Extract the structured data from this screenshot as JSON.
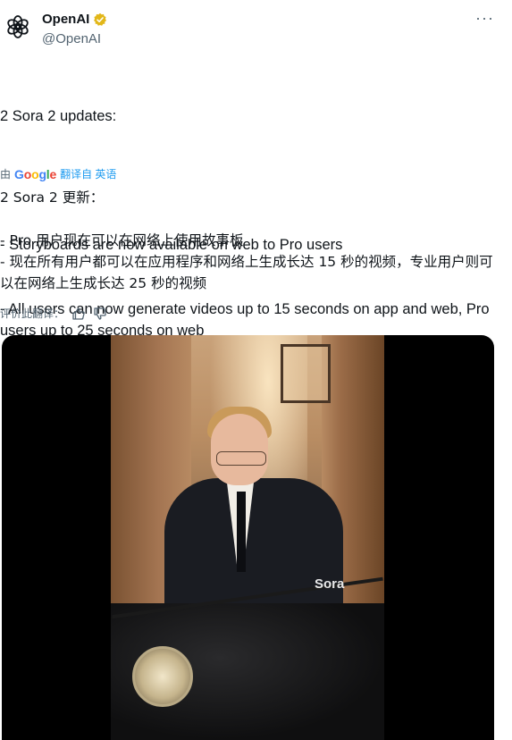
{
  "author": {
    "display_name": "OpenAI",
    "handle": "@OpenAI",
    "avatar_icon": "openai-logo-icon",
    "verified_icon": "verified-gold-badge-icon",
    "verified_color": "#e2b719"
  },
  "more_label": "···",
  "tweet": {
    "lines": [
      "2 Sora 2 updates:",
      "",
      "- Storyboards are now available on web to Pro users",
      "- All users can now generate videos up to 15 seconds on app and web, Pro users up to 25 seconds on web"
    ]
  },
  "translation": {
    "by_prefix": "由",
    "google_letters": [
      "G",
      "o",
      "o",
      "g",
      "l",
      "e"
    ],
    "link_label": "翻译自 英语",
    "lines": [
      "2 Sora 2 更新：",
      "",
      "- Pro 用户现在可以在网络上使用故事板",
      "- 现在所有用户都可以在应用程序和网络上生成长达 15 秒的视频，专业用户则可以在网络上生成长达 25 秒的视频"
    ],
    "rate_label": "评价此翻译：",
    "thumbs_up_icon": "thumbs-up-icon",
    "thumbs_down_icon": "thumbs-down-icon"
  },
  "media": {
    "watermark": "Sora"
  },
  "colors": {
    "text": "#0f1419",
    "secondary": "#536471",
    "link": "#1d9bf0"
  }
}
